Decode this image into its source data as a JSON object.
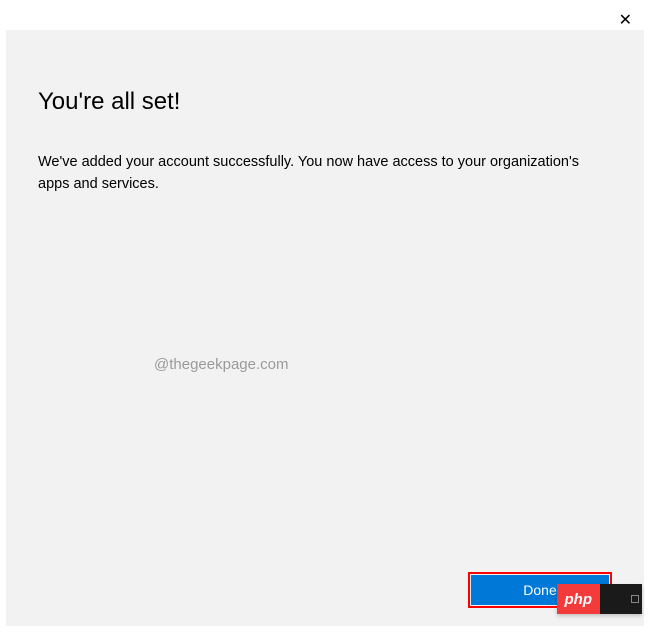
{
  "close_symbol": "✕",
  "dialog": {
    "title": "You're all set!",
    "body": "We've added your account successfully. You now have access to your organization's apps and services.",
    "done_label": "Done"
  },
  "watermark": "@thegeekpage.com",
  "badge": {
    "php": "php"
  },
  "colors": {
    "primary_button": "#0078d7",
    "highlight_border": "#ff0000",
    "dialog_bg": "#f2f2f2",
    "badge_red": "#f43b3b"
  }
}
